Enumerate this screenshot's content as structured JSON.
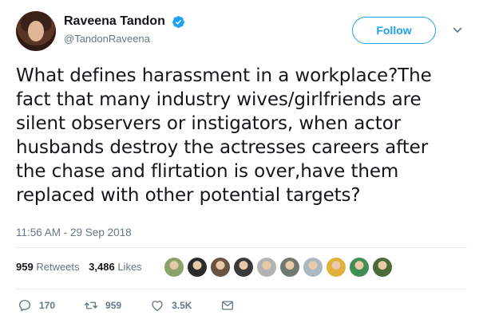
{
  "author": {
    "display_name": "Raveena Tandon",
    "handle": "@TandonRaveena",
    "verified": true
  },
  "follow_button": {
    "label": "Follow"
  },
  "tweet": {
    "lines": [
      "What defines harassment in a workplace?The",
      "fact that many industry wives/girlfriends are",
      "silent observers or instigators, when actor",
      "husbands destroy the actresses careers after",
      "the chase and flirtation is over,have them",
      "replaced with other potential targets?"
    ],
    "timestamp": "11:56 AM - 29 Sep 2018"
  },
  "stats": {
    "retweets_count": "959",
    "retweets_label": "Retweets",
    "likes_count": "3,486",
    "likes_label": "Likes"
  },
  "likers": [
    {
      "color": "#8aa36b"
    },
    {
      "color": "#2b2b2b"
    },
    {
      "color": "#6b5344"
    },
    {
      "color": "#3a3a3a"
    },
    {
      "color": "#b3b3b3"
    },
    {
      "color": "#707a70"
    },
    {
      "color": "#aab8c2"
    },
    {
      "color": "#e0b13c"
    },
    {
      "color": "#3f8f54"
    },
    {
      "color": "#4b6b3a"
    }
  ],
  "actions": {
    "reply_count": "170",
    "retweet_count": "959",
    "like_count": "3.5K"
  },
  "colors": {
    "accent": "#1da1f2",
    "muted": "#657786",
    "text": "#14171a"
  }
}
